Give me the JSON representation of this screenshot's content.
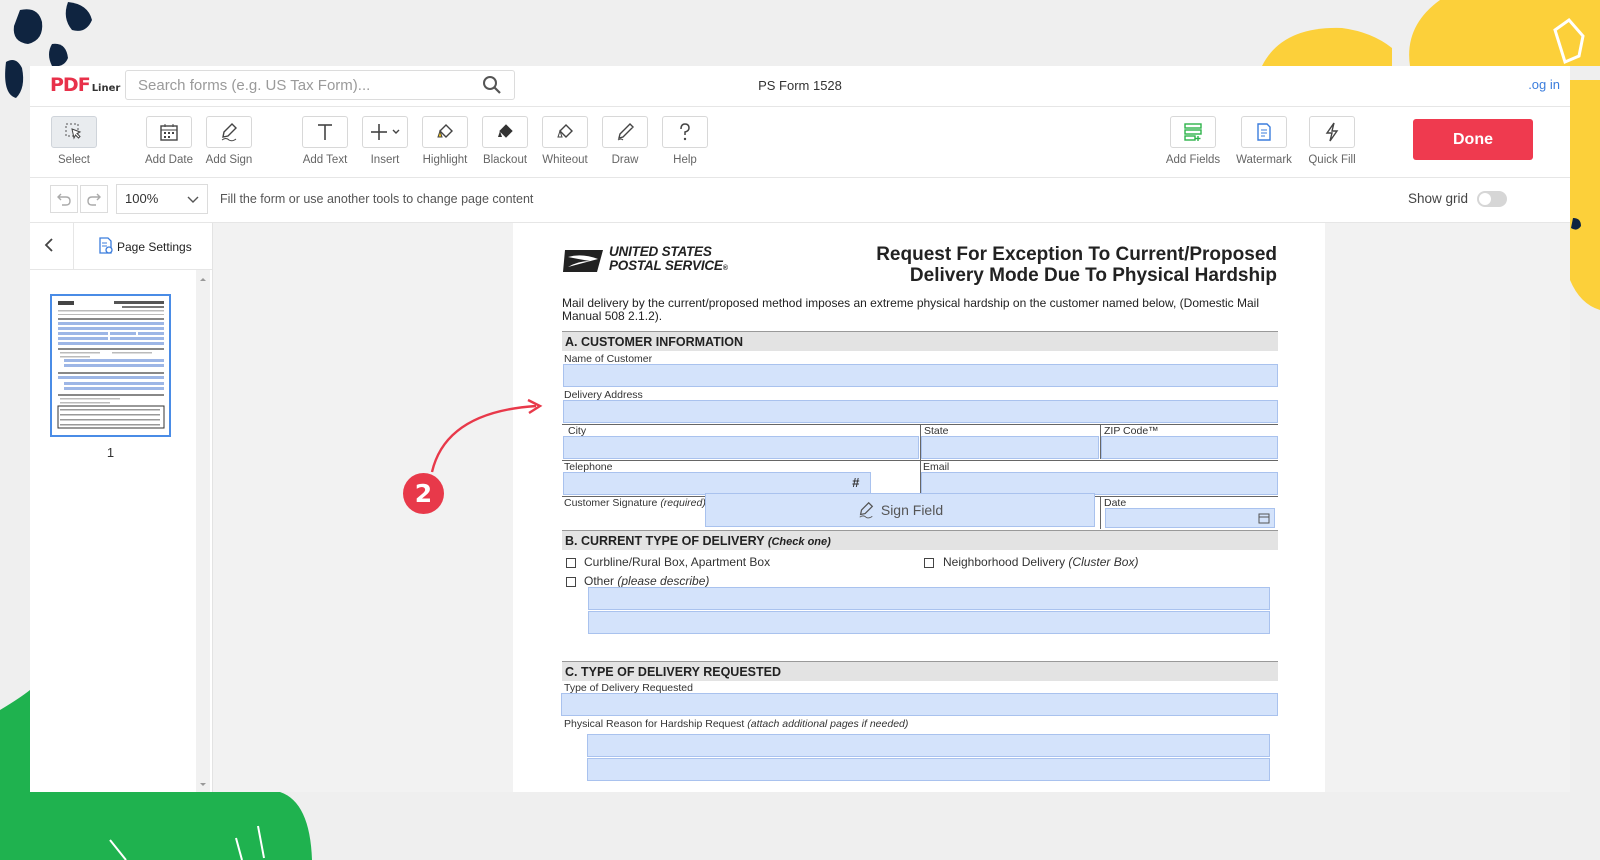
{
  "header": {
    "logo_main": "PDF",
    "logo_sub": "Liner",
    "search_placeholder": "Search forms (e.g. US Tax Form)...",
    "document_title": "PS Form 1528",
    "login_label": ".og in"
  },
  "toolbar": {
    "tools": [
      {
        "label": "Select",
        "icon": "select-cursor-icon"
      },
      {
        "label": "Add Date",
        "icon": "calendar-icon"
      },
      {
        "label": "Add Sign",
        "icon": "pen-sign-icon"
      },
      {
        "label": "Add Text",
        "icon": "text-t-icon"
      },
      {
        "label": "Insert",
        "icon": "plus-icon"
      },
      {
        "label": "Highlight",
        "icon": "highlighter-icon"
      },
      {
        "label": "Blackout",
        "icon": "blackout-icon"
      },
      {
        "label": "Whiteout",
        "icon": "eraser-icon"
      },
      {
        "label": "Draw",
        "icon": "pencil-icon"
      },
      {
        "label": "Help",
        "icon": "question-icon"
      },
      {
        "label": "Add Fields",
        "icon": "fields-icon"
      },
      {
        "label": "Watermark",
        "icon": "watermark-icon"
      },
      {
        "label": "Quick Fill",
        "icon": "lightning-icon"
      }
    ],
    "done_label": "Done"
  },
  "subbar": {
    "zoom_value": "100%",
    "hint": "Fill the form or use another tools to change page content",
    "show_grid_label": "Show grid"
  },
  "sidebar": {
    "page_settings_label": "Page Settings",
    "page_number": "1"
  },
  "form": {
    "usps_line1": "UNITED STATES",
    "usps_line2": "POSTAL SERVICE",
    "title_line1": "Request For Exception To Current/Proposed",
    "title_line2": "Delivery Mode Due To Physical Hardship",
    "intro": "Mail delivery by the current/proposed method imposes an extreme physical hardship on the customer named below, (Domestic Mail Manual 508 2.1.2).",
    "section_a": "A. CUSTOMER INFORMATION",
    "name_label": "Name of Customer",
    "address_label": "Delivery Address",
    "city_label": "City",
    "state_label": "State",
    "zip_label": "ZIP Code™",
    "telephone_label": "Telephone",
    "hash_mark": "#",
    "email_label": "Email",
    "signature_label": "Customer Signature",
    "signature_note": "(required)",
    "sign_field_label": "Sign Field",
    "date_label": "Date",
    "section_b": "B. CURRENT TYPE OF DELIVERY",
    "section_b_note": "(Check one)",
    "opt_curbline": "Curbline/Rural Box, Apartment Box",
    "opt_neighborhood": "Neighborhood Delivery",
    "opt_neighborhood_note": "(Cluster Box)",
    "opt_other": "Other",
    "opt_other_note": "(please describe)",
    "section_c": "C. TYPE OF DELIVERY REQUESTED",
    "type_label": "Type of Delivery Requested",
    "reason_label": "Physical Reason for Hardship Request",
    "reason_note": "(attach additional pages if needed)"
  },
  "annotation": {
    "step_number": "2",
    "accent_color": "#e8394a"
  },
  "colors": {
    "done_button": "#ef3a4f",
    "field_fill": "#d4e3fb",
    "decor_yellow": "#fcd03a",
    "decor_green": "#1fb24f",
    "decor_navy": "#0f2440"
  }
}
